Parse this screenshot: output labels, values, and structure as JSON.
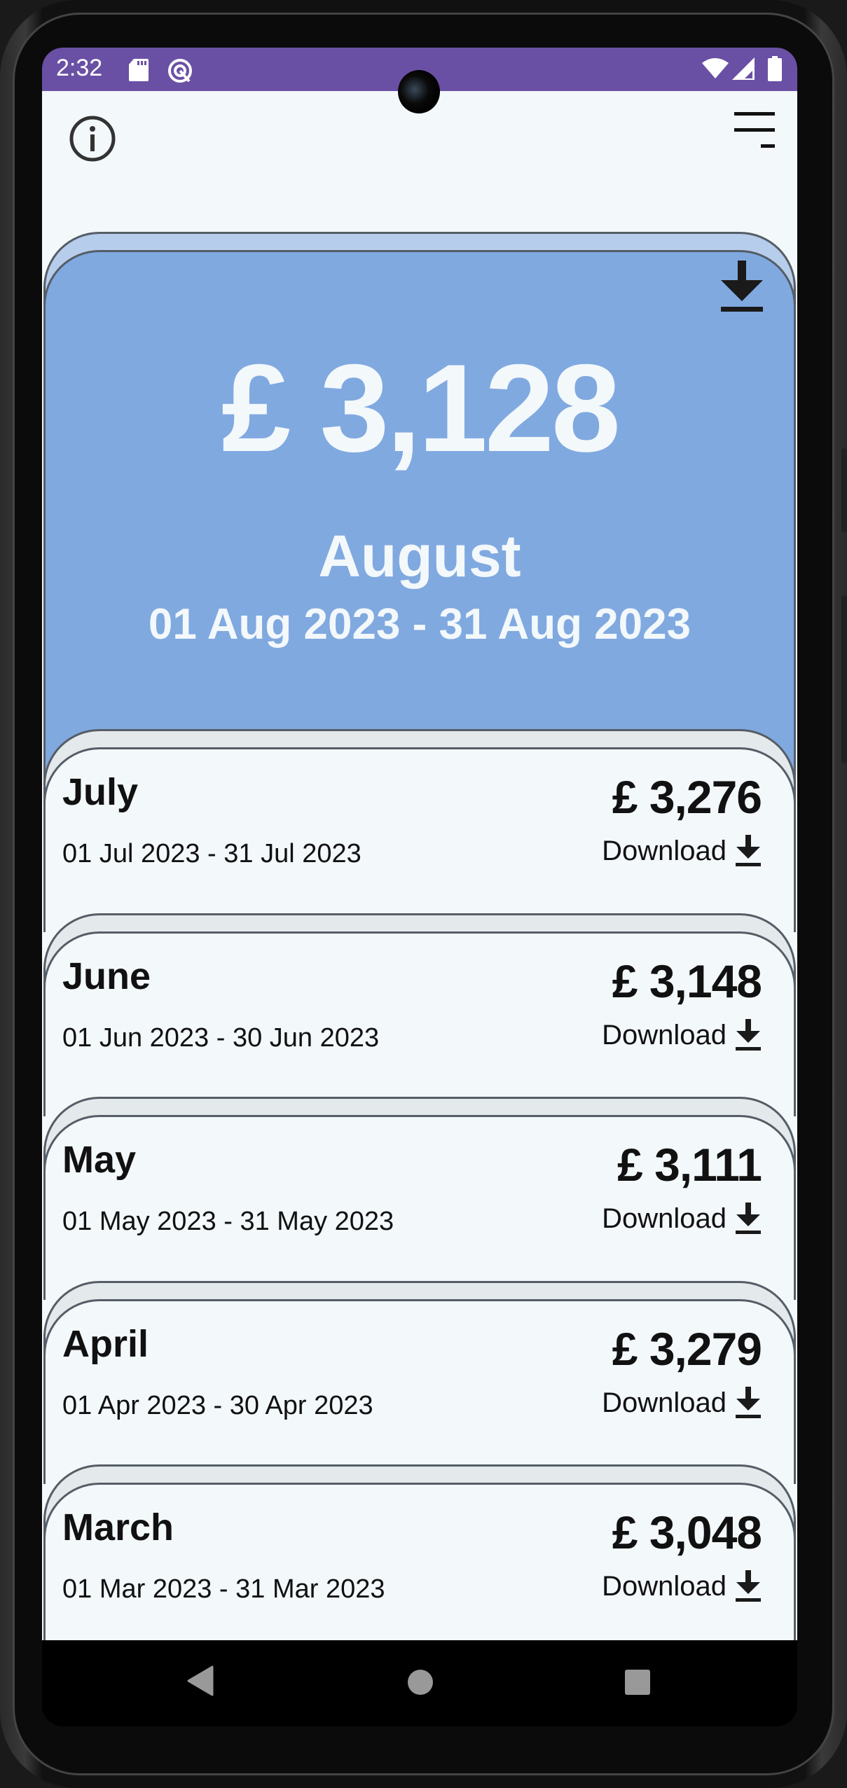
{
  "status_bar": {
    "time": "2:32",
    "left_icons": [
      "sd-card-icon",
      "data-saver-icon"
    ],
    "right_icons": [
      "wifi-icon",
      "cell-signal-icon",
      "battery-icon"
    ]
  },
  "header": {
    "info_button": "info-icon",
    "menu_button": "menu-icon"
  },
  "colors": {
    "status_bar": "#6a50a4",
    "app_background": "#f3f8fb",
    "hero_card": "#80a9e0",
    "hero_card_back": "#b7cdec",
    "list_card_back": "#e4e9ec",
    "card_border": "#555d66",
    "text_dark": "#111111",
    "text_light": "#f3f8fb"
  },
  "current_period": {
    "amount": "£ 3,128",
    "month": "August",
    "range": "01 Aug 2023 - 31 Aug 2023",
    "download_icon": "download-icon"
  },
  "periods": [
    {
      "month": "July",
      "range": "01 Jul 2023 - 31 Jul 2023",
      "amount": "£ 3,276",
      "download_label": "Download"
    },
    {
      "month": "June",
      "range": "01 Jun 2023 - 30 Jun 2023",
      "amount": "£ 3,148",
      "download_label": "Download"
    },
    {
      "month": "May",
      "range": "01 May 2023 - 31 May 2023",
      "amount": "£ 3,111",
      "download_label": "Download"
    },
    {
      "month": "April",
      "range": "01 Apr 2023 - 30 Apr 2023",
      "amount": "£ 3,279",
      "download_label": "Download"
    },
    {
      "month": "March",
      "range": "01 Mar 2023 - 31 Mar 2023",
      "amount": "£ 3,048",
      "download_label": "Download"
    }
  ],
  "nav_bar": {
    "back": "back-icon",
    "home": "home-icon",
    "recents": "recents-icon"
  }
}
